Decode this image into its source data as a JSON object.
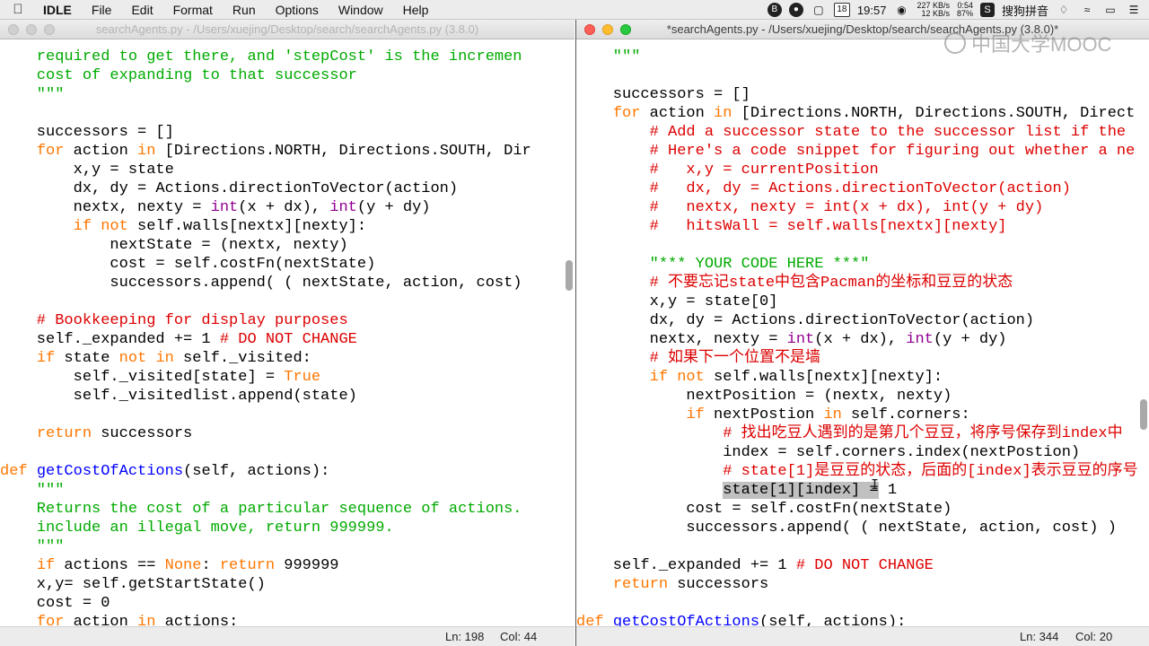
{
  "menubar": {
    "apple": "",
    "app_name": "IDLE",
    "items": [
      "File",
      "Edit",
      "Format",
      "Run",
      "Options",
      "Window",
      "Help"
    ],
    "status": {
      "calendar_day": "18",
      "clock": "19:57",
      "net_up": "227 KB/s",
      "net_down": "12 KB/s",
      "meter_top": "0:54",
      "meter_bottom": "87%",
      "ime_label": "搜狗拼音"
    }
  },
  "left_window": {
    "title": "searchAgents.py - /Users/xuejing/Desktop/search/searchAgents.py (3.8.0)",
    "status": {
      "ln": "Ln: 198",
      "col": "Col: 44"
    },
    "lines": [
      [
        [
          "str",
          "    required to get there, and 'stepCost' is the incremen"
        ]
      ],
      [
        [
          "str",
          "    cost of expanding to that successor"
        ]
      ],
      [
        [
          "str",
          "    \"\"\""
        ]
      ],
      [
        [
          "",
          ""
        ]
      ],
      [
        [
          "",
          "    successors = []"
        ]
      ],
      [
        [
          "",
          "    "
        ],
        [
          "kw",
          "for"
        ],
        [
          "",
          " action "
        ],
        [
          "kw",
          "in"
        ],
        [
          "",
          " [Directions.NORTH, Directions.SOUTH, Dir"
        ]
      ],
      [
        [
          "",
          "        x,y = state"
        ]
      ],
      [
        [
          "",
          "        dx, dy = Actions.directionToVector(action)"
        ]
      ],
      [
        [
          "",
          "        nextx, nexty = "
        ],
        [
          "bi",
          "int"
        ],
        [
          "",
          "(x + dx), "
        ],
        [
          "bi",
          "int"
        ],
        [
          "",
          "(y + dy)"
        ]
      ],
      [
        [
          "",
          "        "
        ],
        [
          "kw",
          "if not"
        ],
        [
          "",
          " self.walls[nextx][nexty]:"
        ]
      ],
      [
        [
          "",
          "            nextState = (nextx, nexty)"
        ]
      ],
      [
        [
          "",
          "            cost = self.costFn(nextState)"
        ]
      ],
      [
        [
          "",
          "            successors.append( ( nextState, action, cost)"
        ]
      ],
      [
        [
          "",
          ""
        ]
      ],
      [
        [
          "cmt",
          "    # Bookkeeping for display purposes"
        ]
      ],
      [
        [
          "",
          "    self._expanded += 1 "
        ],
        [
          "cmt",
          "# DO NOT CHANGE"
        ]
      ],
      [
        [
          "",
          "    "
        ],
        [
          "kw",
          "if"
        ],
        [
          "",
          " state "
        ],
        [
          "kw",
          "not in"
        ],
        [
          "",
          " self._visited:"
        ]
      ],
      [
        [
          "",
          "        self._visited[state] = "
        ],
        [
          "kw",
          "True"
        ]
      ],
      [
        [
          "",
          "        self._visitedlist.append(state)"
        ]
      ],
      [
        [
          "",
          ""
        ]
      ],
      [
        [
          "",
          "    "
        ],
        [
          "kw",
          "return"
        ],
        [
          "",
          " successors"
        ]
      ],
      [
        [
          "",
          ""
        ]
      ],
      [
        [
          "kw",
          "def"
        ],
        [
          "",
          " "
        ],
        [
          "fn",
          "getCostOfActions"
        ],
        [
          "",
          "(self, actions):"
        ]
      ],
      [
        [
          "str",
          "    \"\"\""
        ]
      ],
      [
        [
          "str",
          "    Returns the cost of a particular sequence of actions."
        ]
      ],
      [
        [
          "str",
          "    include an illegal move, return 999999."
        ]
      ],
      [
        [
          "str",
          "    \"\"\""
        ]
      ],
      [
        [
          "",
          "    "
        ],
        [
          "kw",
          "if"
        ],
        [
          "",
          " actions == "
        ],
        [
          "kw",
          "None"
        ],
        [
          "",
          ": "
        ],
        [
          "kw",
          "return"
        ],
        [
          "",
          " 999999"
        ]
      ],
      [
        [
          "",
          "    x,y= self.getStartState()"
        ]
      ],
      [
        [
          "",
          "    cost = 0"
        ]
      ],
      [
        [
          "",
          "    "
        ],
        [
          "kw",
          "for"
        ],
        [
          "",
          " action "
        ],
        [
          "kw",
          "in"
        ],
        [
          "",
          " actions:"
        ]
      ]
    ]
  },
  "right_window": {
    "title": "*searchAgents.py - /Users/xuejing/Desktop/search/searchAgents.py (3.8.0)*",
    "status": {
      "ln": "Ln: 344",
      "col": "Col: 20"
    },
    "lines": [
      [
        [
          "str",
          "    \"\"\""
        ]
      ],
      [
        [
          "",
          ""
        ]
      ],
      [
        [
          "",
          "    successors = []"
        ]
      ],
      [
        [
          "",
          "    "
        ],
        [
          "kw",
          "for"
        ],
        [
          "",
          " action "
        ],
        [
          "kw",
          "in"
        ],
        [
          "",
          " [Directions.NORTH, Directions.SOUTH, Direct"
        ]
      ],
      [
        [
          "cmt",
          "        # Add a successor state to the successor list if the"
        ]
      ],
      [
        [
          "cmt",
          "        # Here's a code snippet for figuring out whether a ne"
        ]
      ],
      [
        [
          "cmt",
          "        #   x,y = currentPosition"
        ]
      ],
      [
        [
          "cmt",
          "        #   dx, dy = Actions.directionToVector(action)"
        ]
      ],
      [
        [
          "cmt",
          "        #   nextx, nexty = int(x + dx), int(y + dy)"
        ]
      ],
      [
        [
          "cmt",
          "        #   hitsWall = self.walls[nextx][nexty]"
        ]
      ],
      [
        [
          "",
          ""
        ]
      ],
      [
        [
          "str",
          "        \"*** YOUR CODE HERE ***\""
        ]
      ],
      [
        [
          "cmt",
          "        # 不要忘记state中包含Pacman的坐标和豆豆的状态"
        ]
      ],
      [
        [
          "",
          "        x,y = state[0]"
        ]
      ],
      [
        [
          "",
          "        dx, dy = Actions.directionToVector(action)"
        ]
      ],
      [
        [
          "",
          "        nextx, nexty = "
        ],
        [
          "bi",
          "int"
        ],
        [
          "",
          "(x + dx), "
        ],
        [
          "bi",
          "int"
        ],
        [
          "",
          "(y + dy)"
        ]
      ],
      [
        [
          "cmt",
          "        # 如果下一个位置不是墙"
        ]
      ],
      [
        [
          "",
          "        "
        ],
        [
          "kw",
          "if not"
        ],
        [
          "",
          " self.walls[nextx][nexty]:"
        ]
      ],
      [
        [
          "",
          "            nextPosition = (nextx, nexty)"
        ]
      ],
      [
        [
          "",
          "            "
        ],
        [
          "kw",
          "if"
        ],
        [
          "",
          " nextPostion "
        ],
        [
          "kw",
          "in"
        ],
        [
          "",
          " self.corners:"
        ]
      ],
      [
        [
          "cmt",
          "                # 找出吃豆人遇到的是第几个豆豆，将序号保存到index中"
        ]
      ],
      [
        [
          "",
          "                index = self.corners.index(nextPostion)"
        ]
      ],
      [
        [
          "cmt",
          "                # state[1]是豆豆的状态，后面的[index]表示豆豆的序号"
        ]
      ],
      [
        [
          "",
          "                "
        ],
        [
          "sel",
          "state[1][index] ="
        ],
        [
          "",
          " 1"
        ]
      ],
      [
        [
          "",
          "            cost = self.costFn(nextState)"
        ]
      ],
      [
        [
          "",
          "            successors.append( ( nextState, action, cost) )"
        ]
      ],
      [
        [
          "",
          ""
        ]
      ],
      [
        [
          "",
          "    self._expanded += 1 "
        ],
        [
          "cmt",
          "# DO NOT CHANGE"
        ]
      ],
      [
        [
          "",
          "    "
        ],
        [
          "kw",
          "return"
        ],
        [
          "",
          " successors"
        ]
      ],
      [
        [
          "",
          ""
        ]
      ],
      [
        [
          "kw",
          "def"
        ],
        [
          "",
          " "
        ],
        [
          "fn",
          "getCostOfActions"
        ],
        [
          "",
          "(self, actions):"
        ]
      ],
      [
        [
          "str",
          "    \"\"\""
        ]
      ]
    ]
  },
  "watermark": {
    "text": "中国大学MOOC"
  }
}
